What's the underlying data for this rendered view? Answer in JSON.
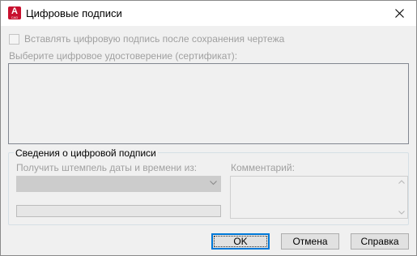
{
  "window": {
    "title": "Цифровые подписи",
    "app_icon": {
      "letter": "A",
      "caption": "CAD",
      "color": "#c8102e"
    },
    "close_icon": "close-icon"
  },
  "options": {
    "attach_after_save": {
      "label": "Вставлять цифровую подпись после сохранения чертежа",
      "checked": false
    }
  },
  "certificate": {
    "label": "Выберите цифровое удостоверение (сертификат):",
    "items": []
  },
  "signature_info": {
    "group_title": "Сведения о цифровой подписи",
    "timestamp_label": "Получить штемпель даты и времени из:",
    "timestamp_value": "",
    "comment_label": "Комментарий:",
    "comment_value": ""
  },
  "buttons": {
    "ok": "OK",
    "cancel": "Отмена",
    "help": "Справка"
  },
  "colors": {
    "focus_border": "#0078d7",
    "disabled_text": "#a0a0a0"
  }
}
